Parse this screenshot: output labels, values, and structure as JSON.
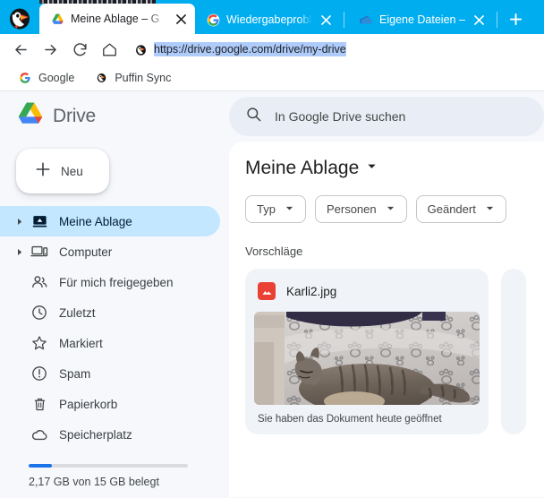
{
  "browser": {
    "app_icon": "puffin-icon",
    "tabs": [
      {
        "title": "Meine Ablage – G",
        "favicon": "google-drive-icon",
        "active": true,
        "close_label": "×"
      },
      {
        "title": "Wiedergabeprobl",
        "favicon": "google-icon",
        "active": false,
        "close_label": "×"
      },
      {
        "title": "Eigene Dateien –",
        "favicon": "onedrive-cloud-icon",
        "active": false,
        "close_label": "×"
      }
    ],
    "new_tab_label": "+",
    "toolbar": {
      "back_icon": "arrow-back-icon",
      "forward_icon": "arrow-forward-icon",
      "reload_icon": "reload-icon",
      "home_icon": "home-icon",
      "site_icon": "puffin-icon",
      "url": "https://drive.google.com/drive/my-drive",
      "url_selected": true
    },
    "bookmarks": [
      {
        "label": "Google",
        "icon": "google-icon"
      },
      {
        "label": "Puffin Sync",
        "icon": "puffin-icon"
      }
    ],
    "colors": {
      "titlebar": "#00adef",
      "selection": "#aecbfa"
    }
  },
  "drive": {
    "brand": {
      "name": "Drive",
      "logo": "google-drive-logo"
    },
    "search": {
      "icon": "search-icon",
      "placeholder": "In Google Drive suchen",
      "value": ""
    },
    "new_button": {
      "label": "Neu",
      "icon": "plus-icon"
    },
    "sidebar": {
      "items": [
        {
          "label": "Meine Ablage",
          "icon": "my-drive-icon",
          "caret": true,
          "active": true
        },
        {
          "label": "Computer",
          "icon": "computer-icon",
          "caret": true,
          "active": false
        },
        {
          "label": "Für mich freigegeben",
          "icon": "shared-people-icon",
          "caret": false,
          "active": false
        },
        {
          "label": "Zuletzt",
          "icon": "clock-icon",
          "caret": false,
          "active": false
        },
        {
          "label": "Markiert",
          "icon": "star-icon",
          "caret": false,
          "active": false
        },
        {
          "label": "Spam",
          "icon": "spam-icon",
          "caret": false,
          "active": false
        },
        {
          "label": "Papierkorb",
          "icon": "trash-icon",
          "caret": false,
          "active": false
        },
        {
          "label": "Speicherplatz",
          "icon": "cloud-icon",
          "caret": false,
          "active": false
        }
      ],
      "storage": {
        "label": "2,17 GB von 15 GB belegt",
        "used_gb": 2.17,
        "total_gb": 15,
        "percent": 14.5,
        "fill_color": "#1a73e8"
      }
    },
    "main": {
      "title": "Meine Ablage",
      "title_caret_icon": "chevron-down-icon",
      "filters": [
        {
          "label": "Typ",
          "icon": "chevron-down-icon"
        },
        {
          "label": "Personen",
          "icon": "chevron-down-icon"
        },
        {
          "label": "Geändert",
          "icon": "chevron-down-icon"
        }
      ],
      "section_label": "Vorschläge",
      "cards": [
        {
          "name": "Karli2.jpg",
          "file_icon": "image-file-icon",
          "icon_color": "#e94235",
          "caption": "Sie haben das Dokument heute geöffnet",
          "thumbnail": "cat-on-pawprint-blanket-photo"
        }
      ]
    }
  }
}
